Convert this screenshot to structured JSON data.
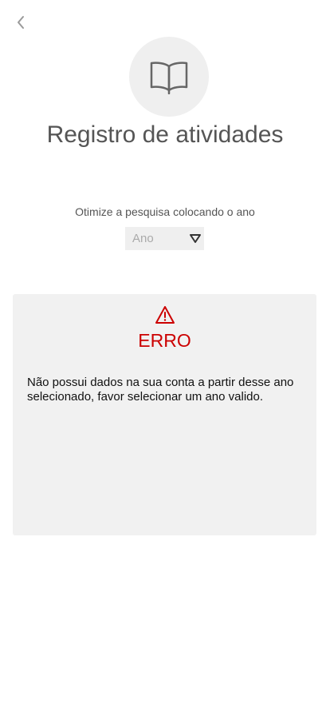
{
  "header": {
    "back_icon": "chevron-left-icon",
    "hero_icon": "open-book-icon",
    "title": "Registro de atividades"
  },
  "filter": {
    "hint": "Otimize a pesquisa colocando o ano",
    "year_placeholder": "Ano",
    "dropdown_icon": "triangle-down-icon"
  },
  "error": {
    "icon": "warning-triangle-icon",
    "title": "ERRO",
    "message": "Não possui dados na sua conta a partir desse ano selecionado, favor selecionar um ano valido."
  },
  "colors": {
    "error_red": "#cc0000",
    "card_bg": "#f1f1f1",
    "title_gray": "#555555"
  }
}
